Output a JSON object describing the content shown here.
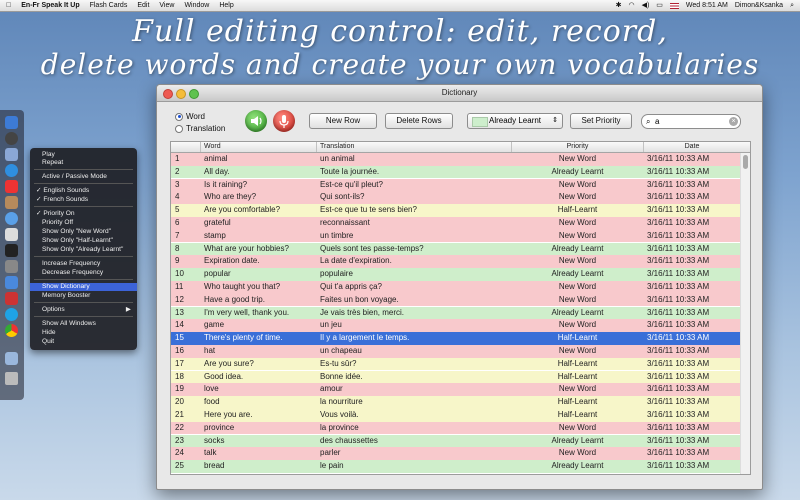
{
  "menubar": {
    "app_name": "En-Fr Speak It Up",
    "menus": [
      "Flash Cards",
      "Edit",
      "View",
      "Window",
      "Help"
    ],
    "clock": "Wed 8:51 AM",
    "user": "Dimon&Ksanka"
  },
  "headline": {
    "line1": "Full editing control:  edit, record,",
    "line2": "delete words and create your  own vocabularies"
  },
  "context_menu": {
    "items": [
      "Play",
      "Repeat",
      "Active / Passive Mode",
      "✓ English Sounds",
      "✓ French Sounds",
      "✓ Priority On",
      "Priority Off",
      "Show Only \"New Word\"",
      "Show Only \"Half-Learnt\"",
      "Show Only \"Already Learnt\"",
      "Increase Frequency",
      "Decrease Frequency",
      "Show Dictionary",
      "Memory Booster",
      "Options",
      "Show All Windows",
      "Hide",
      "Quit"
    ],
    "selected": "Show Dictionary",
    "submenu_arrow": "▶"
  },
  "window": {
    "title": "Dictionary",
    "radio_word": "Word",
    "radio_translation": "Translation",
    "new_row": "New Row",
    "delete_rows": "Delete Rows",
    "priority_select": "Already Learnt",
    "set_priority": "Set Priority",
    "search_value": "a"
  },
  "colors": {
    "new_word": "#f8c9cc",
    "half_learnt": "#f7f6c9",
    "already_learnt": "#cfeecb",
    "selected": "#3a6fd8"
  },
  "table": {
    "headers": [
      "Word",
      "Translation",
      "Priority",
      "Date"
    ],
    "rows": [
      {
        "n": "1",
        "word": "animal",
        "tr": "un animal",
        "pri": "New Word",
        "date": "3/16/11 10:33 AM"
      },
      {
        "n": "2",
        "word": "All day.",
        "tr": "Toute la journée.",
        "pri": "Already Learnt",
        "date": "3/16/11 10:33 AM"
      },
      {
        "n": "3",
        "word": "Is it raining?",
        "tr": "Est-ce qu'il pleut?",
        "pri": "New Word",
        "date": "3/16/11 10:33 AM"
      },
      {
        "n": "4",
        "word": "Who are they?",
        "tr": "Qui sont-ils?",
        "pri": "New Word",
        "date": "3/16/11 10:33 AM"
      },
      {
        "n": "5",
        "word": "Are you comfortable?",
        "tr": "Est-ce que tu te sens bien?",
        "pri": "Half-Learnt",
        "date": "3/16/11 10:33 AM"
      },
      {
        "n": "6",
        "word": "grateful",
        "tr": "reconnaissant",
        "pri": "New Word",
        "date": "3/16/11 10:33 AM"
      },
      {
        "n": "7",
        "word": "stamp",
        "tr": "un timbre",
        "pri": "New Word",
        "date": "3/16/11 10:33 AM"
      },
      {
        "n": "8",
        "word": "What are your hobbies?",
        "tr": "Quels sont tes passe-temps?",
        "pri": "Already Learnt",
        "date": "3/16/11 10:33 AM"
      },
      {
        "n": "9",
        "word": "Expiration date.",
        "tr": "La date d'expiration.",
        "pri": "New Word",
        "date": "3/16/11 10:33 AM"
      },
      {
        "n": "10",
        "word": "popular",
        "tr": "populaire",
        "pri": "Already Learnt",
        "date": "3/16/11 10:33 AM"
      },
      {
        "n": "11",
        "word": "Who taught you that?",
        "tr": "Qui t'a appris ça?",
        "pri": "New Word",
        "date": "3/16/11 10:33 AM"
      },
      {
        "n": "12",
        "word": "Have a good trip.",
        "tr": "Faites un bon voyage.",
        "pri": "New Word",
        "date": "3/16/11 10:33 AM"
      },
      {
        "n": "13",
        "word": "I'm very well, thank you.",
        "tr": "Je vais très bien, merci.",
        "pri": "Already Learnt",
        "date": "3/16/11 10:33 AM"
      },
      {
        "n": "14",
        "word": "game",
        "tr": "un jeu",
        "pri": "New Word",
        "date": "3/16/11 10:33 AM"
      },
      {
        "n": "15",
        "word": "There's plenty of time.",
        "tr": "Il y a largement le temps.",
        "pri": "Half-Learnt",
        "date": "3/16/11 10:33 AM"
      },
      {
        "n": "16",
        "word": "hat",
        "tr": "un chapeau",
        "pri": "New Word",
        "date": "3/16/11 10:33 AM"
      },
      {
        "n": "17",
        "word": "Are you sure?",
        "tr": "Es-tu sûr?",
        "pri": "Half-Learnt",
        "date": "3/16/11 10:33 AM"
      },
      {
        "n": "18",
        "word": "Good idea.",
        "tr": "Bonne idée.",
        "pri": "Half-Learnt",
        "date": "3/16/11 10:33 AM"
      },
      {
        "n": "19",
        "word": "love",
        "tr": "amour",
        "pri": "New Word",
        "date": "3/16/11 10:33 AM"
      },
      {
        "n": "20",
        "word": "food",
        "tr": "la nourriture",
        "pri": "Half-Learnt",
        "date": "3/16/11 10:33 AM"
      },
      {
        "n": "21",
        "word": "Here you are.",
        "tr": "Vous voilà.",
        "pri": "Half-Learnt",
        "date": "3/16/11 10:33 AM"
      },
      {
        "n": "22",
        "word": "province",
        "tr": "la province",
        "pri": "New Word",
        "date": "3/16/11 10:33 AM"
      },
      {
        "n": "23",
        "word": "socks",
        "tr": "des chaussettes",
        "pri": "Already Learnt",
        "date": "3/16/11 10:33 AM"
      },
      {
        "n": "24",
        "word": "talk",
        "tr": "parler",
        "pri": "New Word",
        "date": "3/16/11 10:33 AM"
      },
      {
        "n": "25",
        "word": "bread",
        "tr": "le pain",
        "pri": "Already Learnt",
        "date": "3/16/11 10:33 AM"
      }
    ],
    "selected_row": "15"
  }
}
